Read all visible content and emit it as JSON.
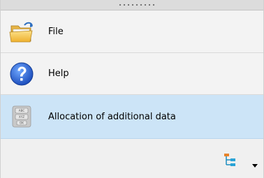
{
  "navigation": {
    "items": [
      {
        "label": "File",
        "icon": "folder-icon",
        "selected": false
      },
      {
        "label": "Help",
        "icon": "help-icon",
        "selected": false
      },
      {
        "label": "Allocation of additional data",
        "icon": "data-allocation-icon",
        "selected": true
      }
    ]
  },
  "icon_text": {
    "abc": "ABC",
    "xyz": "XYZ",
    "ok": "OK"
  },
  "footer": {
    "tree_icon": "tree-structure-icon",
    "menu_icon": "dropdown-arrow-icon"
  },
  "colors": {
    "selected_background": "#cce4f7",
    "item_background": "#f3f3f3",
    "help_blue": "#2b6fe0",
    "folder_yellow": "#f2c02e"
  }
}
